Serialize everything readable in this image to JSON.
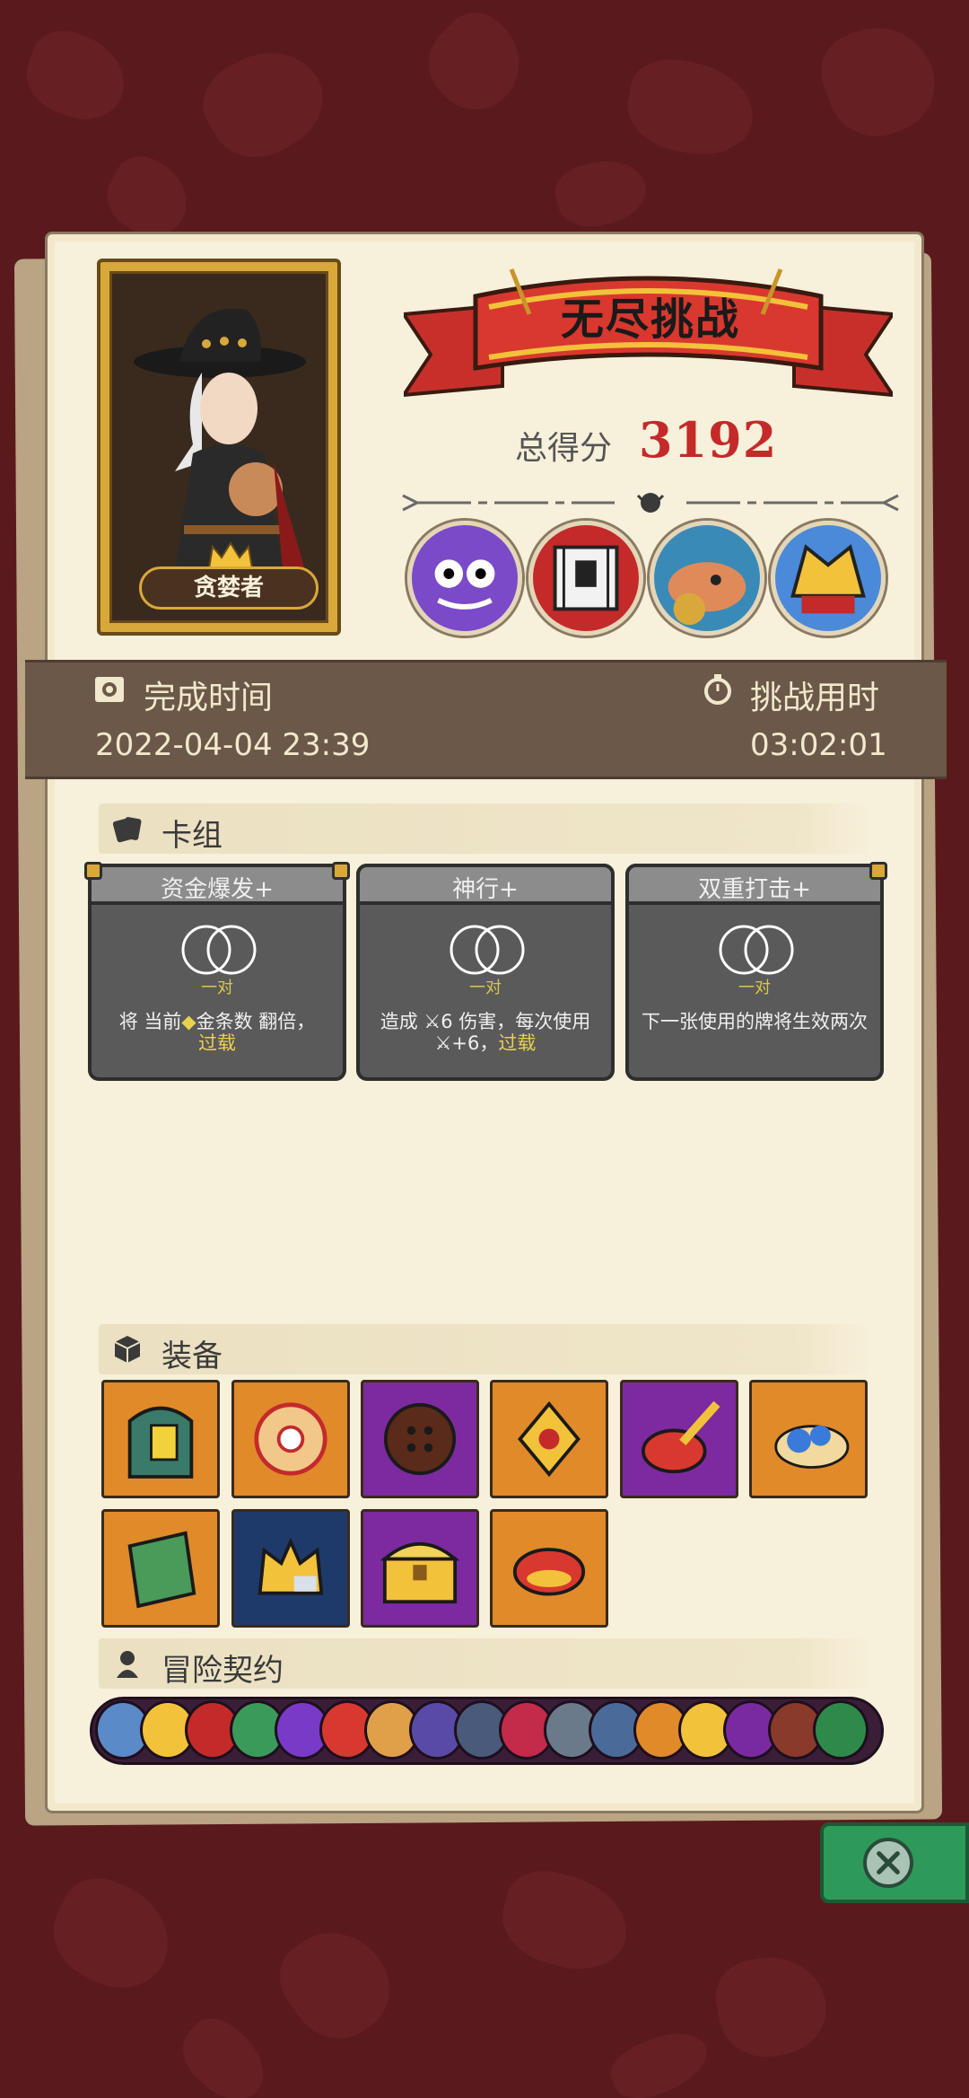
{
  "hero": {
    "name": "贪婪者"
  },
  "mode": {
    "title": "无尽挑战"
  },
  "score": {
    "label": "总得分",
    "value": "3192"
  },
  "info": {
    "finish_label": "完成时间",
    "finish_value": "2022-04-04  23:39",
    "duration_label": "挑战用时",
    "duration_value": "03:02:01"
  },
  "deck": {
    "title": "卡组",
    "cards": [
      {
        "name": "资金爆发+",
        "sub": "一对",
        "desc_a": "将 当前",
        "desc_b": "金条数 翻倍，",
        "desc_hl": "过载"
      },
      {
        "name": "神行+",
        "sub": "一对",
        "desc_a": "造成 ",
        "desc_b": "6 伤害，每次使用",
        "desc_c": "+6，",
        "desc_hl": "过载"
      },
      {
        "name": "双重打击+",
        "sub": "一对",
        "desc_a": "下一张使用的牌将生效两次"
      }
    ]
  },
  "equipment": {
    "title": "装备"
  },
  "contracts": {
    "title": "冒险契约"
  },
  "colors": {
    "accent": "#c42a2a",
    "paper": "#f7f0da",
    "card": "#5a5a5a"
  }
}
